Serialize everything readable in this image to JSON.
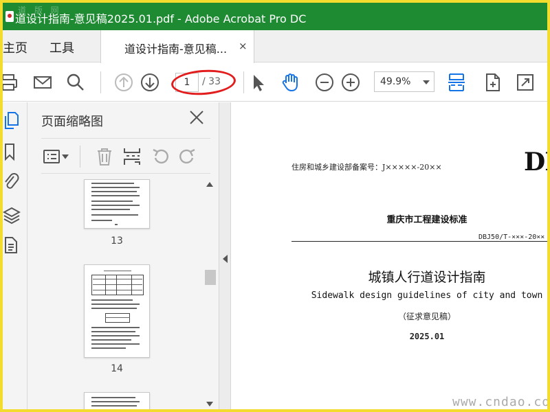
{
  "window": {
    "title": "道设计指南-意见稿2025.01.pdf - Adobe Acrobat Pro DC",
    "watermark": "道 版 网"
  },
  "menu": {
    "home": "主页",
    "tools": "工具"
  },
  "tab": {
    "label": "道设计指南-意见稿...",
    "close": "×"
  },
  "toolbar": {
    "page_current": "1",
    "page_total": "/ 33",
    "zoom": "49.9%"
  },
  "panel": {
    "title": "页面缩略图",
    "thumbnails": [
      {
        "page": "13"
      },
      {
        "page": "14"
      }
    ]
  },
  "document": {
    "record_no": "住房和城乡建设部备案号：J×××××-20××",
    "std_prefix": "DBJ",
    "org": "重庆市工程建设标准",
    "code": "DBJ50/T-×××-20××",
    "title_cn": "城镇人行道设计指南",
    "title_en": "Sidewalk design guidelines of city and town",
    "draft": "（征求意见稿）",
    "date": "2025.01"
  },
  "site_watermark": "www.cndao.com",
  "colors": {
    "titlebar": "#1e8b33",
    "accent_blue": "#1473e6",
    "highlight": "#e21d1d",
    "outer_border": "#f3dc2e"
  }
}
